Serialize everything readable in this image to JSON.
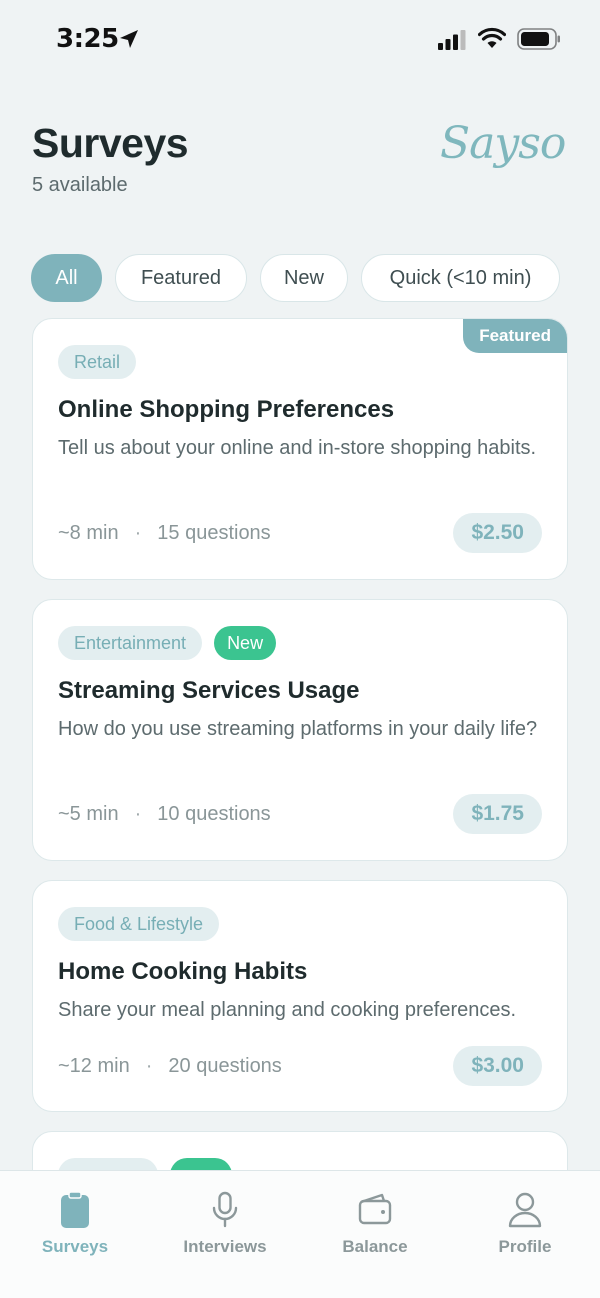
{
  "status_bar": {
    "time": "3:25"
  },
  "header": {
    "title": "Surveys",
    "subtitle": "5 available",
    "brand": "Sayso"
  },
  "filters": [
    {
      "label": "All",
      "active": true
    },
    {
      "label": "Featured",
      "active": false
    },
    {
      "label": "New",
      "active": false
    },
    {
      "label": "Quick (<10 min)",
      "active": false
    }
  ],
  "surveys": [
    {
      "category": "Retail",
      "badge": "",
      "corner_label": "Featured",
      "title": "Online Shopping Preferences",
      "description": "Tell us about your online and in-store shopping habits.",
      "duration": "~8 min",
      "questions": "15 questions",
      "reward": "$2.50"
    },
    {
      "category": "Entertainment",
      "badge": "New",
      "corner_label": "",
      "title": "Streaming Services Usage",
      "description": "How do you use streaming platforms in your daily life?",
      "duration": "~5 min",
      "questions": "10 questions",
      "reward": "$1.75"
    },
    {
      "category": "Food & Lifestyle",
      "badge": "",
      "corner_label": "",
      "title": "Home Cooking Habits",
      "description": "Share your meal planning and cooking preferences.",
      "duration": "~12 min",
      "questions": "20 questions",
      "reward": "$3.00"
    }
  ],
  "tab_bar": [
    {
      "label": "Surveys",
      "icon": "clipboard-icon",
      "active": true
    },
    {
      "label": "Interviews",
      "icon": "microphone-icon",
      "active": false
    },
    {
      "label": "Balance",
      "icon": "wallet-icon",
      "active": false
    },
    {
      "label": "Profile",
      "icon": "person-icon",
      "active": false
    }
  ],
  "colors": {
    "accent": "#7fb3bb",
    "new_badge": "#3bc490",
    "background": "#eff3f4",
    "tag_bg": "#e3eef0"
  }
}
